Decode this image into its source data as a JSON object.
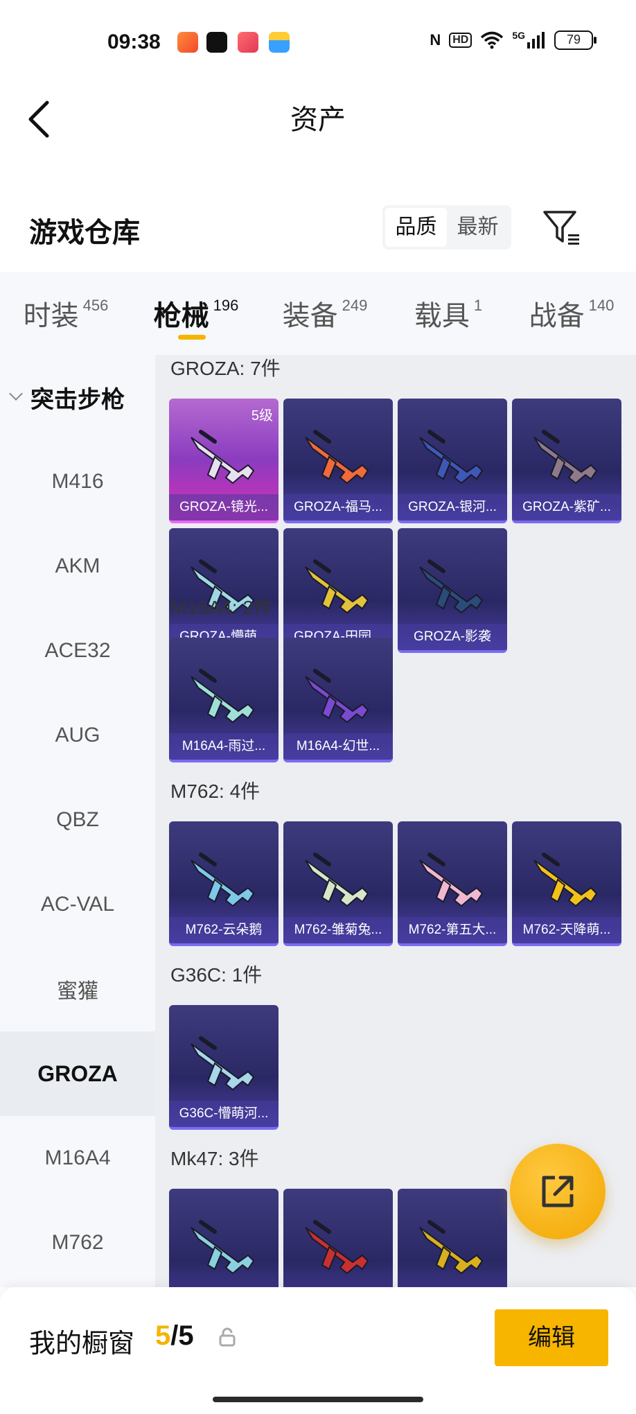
{
  "status_bar": {
    "time": "09:38",
    "hd": "HD",
    "signal": "5G",
    "battery": "79",
    "icons": [
      "app-orange-icon",
      "tiktok-icon",
      "video-app-icon",
      "wallet-app-icon",
      "nfc-icon",
      "wifi-icon",
      "signal-icon"
    ]
  },
  "header": {
    "title": "资产",
    "back_icon": "chevron-left-icon"
  },
  "warehouse": {
    "title": "游戏仓库",
    "sort_options": [
      "品质",
      "最新"
    ],
    "sort_selected": "品质",
    "filter_icon": "filter-icon"
  },
  "categories": [
    {
      "label": "时装",
      "count": "456"
    },
    {
      "label": "枪械",
      "count": "196"
    },
    {
      "label": "装备",
      "count": "249"
    },
    {
      "label": "载具",
      "count": "1"
    },
    {
      "label": "战备",
      "count": "140"
    }
  ],
  "active_category": "枪械",
  "sidebar": {
    "group": "突击步枪",
    "items": [
      "M416",
      "AKM",
      "ACE32",
      "AUG",
      "QBZ",
      "AC-VAL",
      "蜜獾",
      "GROZA",
      "M16A4",
      "M762"
    ],
    "active": "GROZA"
  },
  "groups": [
    {
      "title": "GROZA: 7件",
      "items": [
        {
          "name": "GROZA-镜光...",
          "level": "5级",
          "rarity": "legend",
          "color": "#e8e0f0"
        },
        {
          "name": "GROZA-福马...",
          "rarity": "epic",
          "color": "#f06a3a"
        },
        {
          "name": "GROZA-银河...",
          "rarity": "epic",
          "color": "#3f58b8"
        },
        {
          "name": "GROZA-紫矿...",
          "rarity": "epic",
          "color": "#8e7a8a"
        },
        {
          "name": "GROZA-懵萌...",
          "rarity": "epic",
          "color": "#9ed8e6"
        },
        {
          "name": "GROZA-田园...",
          "rarity": "epic",
          "color": "#e2c23a"
        },
        {
          "name": "GROZA-影袭",
          "rarity": "epic",
          "color": "#2b4c7a"
        }
      ]
    },
    {
      "title": "M16A4: 2件",
      "items": [
        {
          "name": "M16A4-雨过...",
          "rarity": "epic",
          "color": "#9ee0d8"
        },
        {
          "name": "M16A4-幻世...",
          "rarity": "epic",
          "color": "#7a4ad0"
        }
      ]
    },
    {
      "title": "M762: 4件",
      "items": [
        {
          "name": "M762-云朵鹅",
          "rarity": "epic",
          "color": "#7ec8ea"
        },
        {
          "name": "M762-雏菊兔...",
          "rarity": "epic",
          "color": "#d8e6c8"
        },
        {
          "name": "M762-第五大...",
          "rarity": "epic",
          "color": "#f0b8d0"
        },
        {
          "name": "M762-天降萌...",
          "rarity": "epic",
          "color": "#f2c21a"
        }
      ]
    },
    {
      "title": "G36C: 1件",
      "items": [
        {
          "name": "G36C-懵萌河...",
          "rarity": "epic",
          "color": "#a8d6ea"
        }
      ]
    },
    {
      "title": "Mk47: 3件",
      "items": [
        {
          "name": "",
          "rarity": "epic",
          "color": "#8ad0e0"
        },
        {
          "name": "",
          "rarity": "epic",
          "color": "#c83030"
        },
        {
          "name": "",
          "rarity": "epic",
          "color": "#d8b020"
        }
      ]
    }
  ],
  "fab": {
    "icon": "share-external-icon"
  },
  "bottom": {
    "label": "我的橱窗",
    "current": "5",
    "separator": "/",
    "max": "5",
    "lock_icon": "lock-icon",
    "edit_label": "编辑"
  },
  "colors": {
    "accent": "#f5b400",
    "card_bg": "#2a2864",
    "legend_bg": "#d92fb4"
  }
}
